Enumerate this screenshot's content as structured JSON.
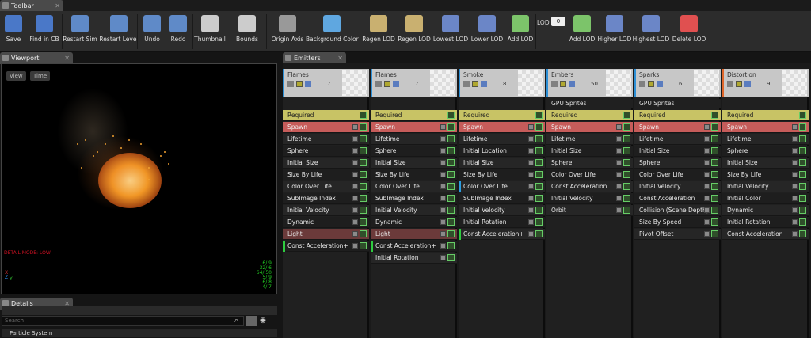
{
  "tabs": {
    "toolbar": "Toolbar",
    "viewport": "Viewport",
    "emitters": "Emitters",
    "details": "Details"
  },
  "toolbar": {
    "buttons": [
      {
        "label": "Save",
        "icon": "save-icon"
      },
      {
        "label": "Find in CB",
        "icon": "find-icon"
      },
      {
        "label": "Restart Sim",
        "icon": "restart-sim-icon"
      },
      {
        "label": "Restart Level",
        "icon": "restart-level-icon"
      },
      {
        "label": "Undo",
        "icon": "undo-icon"
      },
      {
        "label": "Redo",
        "icon": "redo-icon"
      },
      {
        "label": "Thumbnail",
        "icon": "thumbnail-icon"
      },
      {
        "label": "Bounds",
        "icon": "bounds-icon"
      },
      {
        "label": "Origin Axis",
        "icon": "origin-axis-icon"
      },
      {
        "label": "Background Color",
        "icon": "background-color-icon"
      },
      {
        "label": "Regen LOD",
        "icon": "regen-lod-icon"
      },
      {
        "label": "Regen LOD",
        "icon": "regen-lod-2-icon"
      },
      {
        "label": "Lowest LOD",
        "icon": "lowest-lod-icon"
      },
      {
        "label": "Lower LOD",
        "icon": "lower-lod-icon"
      },
      {
        "label": "Add LOD",
        "icon": "add-lod-before-icon"
      },
      {
        "label": "Add LOD",
        "icon": "add-lod-after-icon"
      },
      {
        "label": "Higher LOD",
        "icon": "higher-lod-icon"
      },
      {
        "label": "Highest LOD",
        "icon": "highest-lod-icon"
      },
      {
        "label": "Delete LOD",
        "icon": "delete-lod-icon"
      }
    ],
    "lod_label": "LOD",
    "lod_value": "0"
  },
  "viewport": {
    "view_btn": "View",
    "time_btn": "Time",
    "detail_mode": "DETAIL MODE: LOW",
    "stats": [
      "6/ 9",
      "32/ 6",
      "64/ 50",
      "5/ 9",
      "6/ 8",
      "4/ 7"
    ]
  },
  "details": {
    "search_placeholder": "Search",
    "section": "Particle System"
  },
  "emitters": [
    {
      "name": "Flames",
      "count": "7",
      "accent": "#2c8fd6",
      "sub": "",
      "modules": [
        "Required",
        "Spawn",
        "Lifetime",
        "Sphere",
        "Initial Size",
        "Size By Life",
        "Color Over Life",
        "SubImage Index",
        "Initial Velocity",
        "Dynamic",
        "Light",
        "Const Acceleration+"
      ]
    },
    {
      "name": "Flames",
      "count": "7",
      "accent": "#2c8fd6",
      "sub": "",
      "modules": [
        "Required",
        "Spawn",
        "Lifetime",
        "Sphere",
        "Initial Size",
        "Size By Life",
        "Color Over Life",
        "SubImage Index",
        "Initial Velocity",
        "Dynamic",
        "Light",
        "Const Acceleration+",
        "Initial Rotation"
      ]
    },
    {
      "name": "Smoke",
      "count": "8",
      "accent": "#2c8fd6",
      "sub": "",
      "modules": [
        "Required",
        "Spawn",
        "Lifetime",
        "Initial Location",
        "Initial Size",
        "Size By Life",
        "Color Over Life",
        "SubImage Index",
        "Initial Velocity",
        "Initial Rotation",
        "Const Acceleration+"
      ]
    },
    {
      "name": "Embers",
      "count": "50",
      "accent": "#2c8fd6",
      "sub": "GPU Sprites",
      "modules": [
        "Required",
        "Spawn",
        "Lifetime",
        "Initial Size",
        "Sphere",
        "Color Over Life",
        "Const Acceleration",
        "Initial Velocity",
        "Orbit"
      ]
    },
    {
      "name": "Sparks",
      "count": "6",
      "accent": "#2c8fd6",
      "sub": "GPU Sprites",
      "modules": [
        "Required",
        "Spawn",
        "Lifetime",
        "Initial Size",
        "Sphere",
        "Color Over Life",
        "Initial Velocity",
        "Const Acceleration",
        "Collision (Scene Depth)",
        "Size By Speed",
        "Pivot Offset"
      ]
    },
    {
      "name": "Distortion",
      "count": "9",
      "accent": "#e0662a",
      "sub": "",
      "modules": [
        "Required",
        "Spawn",
        "Lifetime",
        "Sphere",
        "Initial Size",
        "Size By Life",
        "Initial Velocity",
        "Initial Color",
        "Dynamic",
        "Initial Rotation",
        "Const Acceleration"
      ]
    }
  ]
}
